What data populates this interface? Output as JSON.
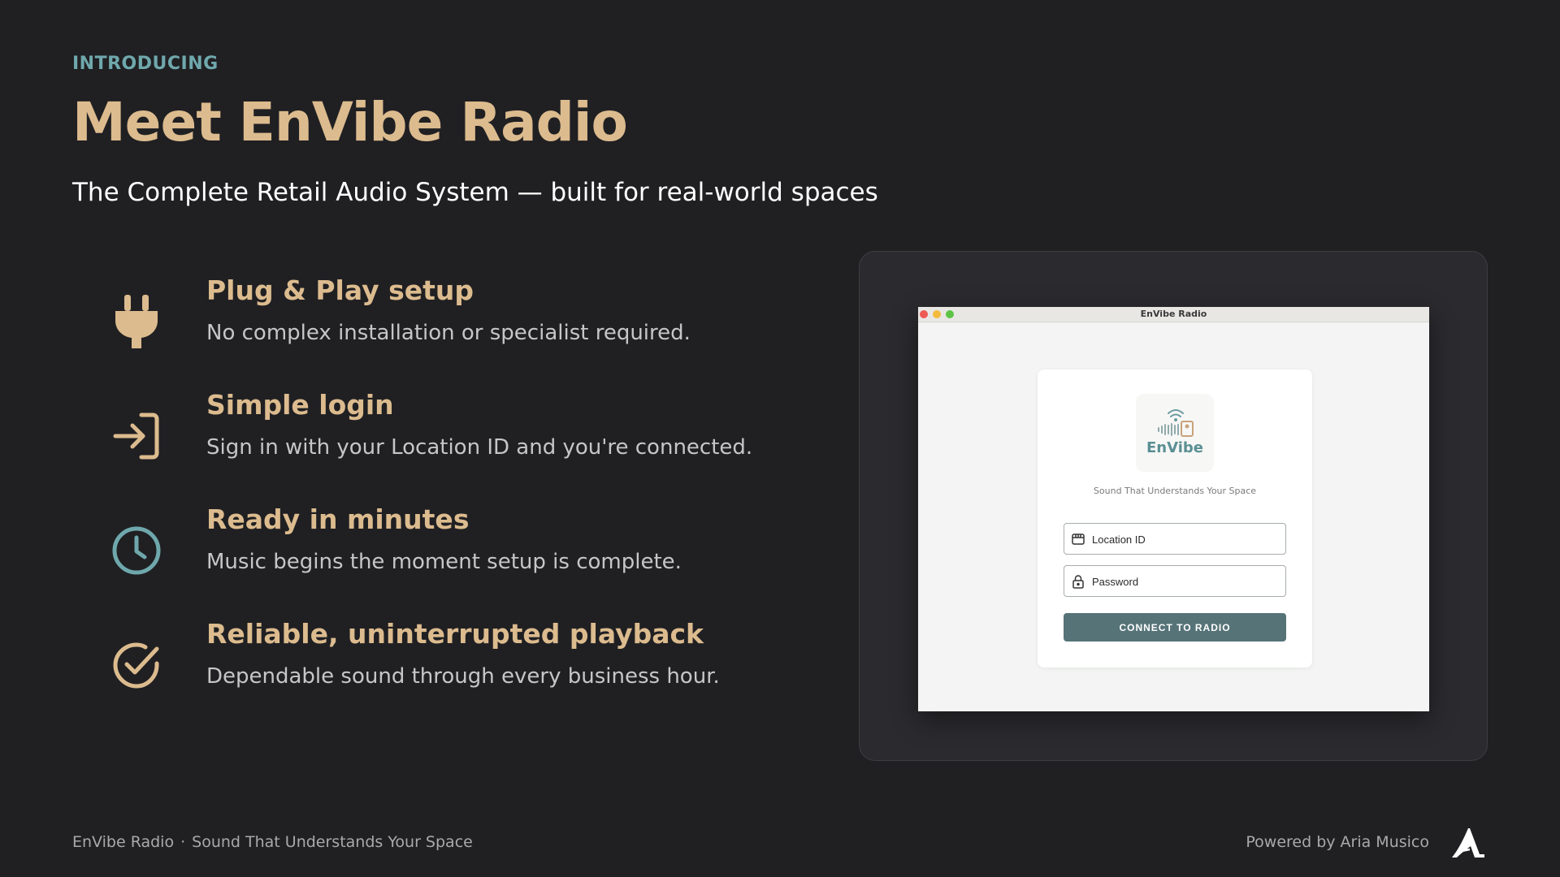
{
  "slide": {
    "eyebrow": "INTRODUCING",
    "title": "Meet EnVibe Radio",
    "subtitle": "The Complete Retail Audio System — built for real-world spaces"
  },
  "features": [
    {
      "icon": "plug-icon",
      "title": "Plug & Play setup",
      "description": "No complex installation or specialist required."
    },
    {
      "icon": "sign-in-icon",
      "title": "Simple login",
      "description": "Sign in with your Location ID and you're connected."
    },
    {
      "icon": "clock-icon",
      "title": "Ready in minutes",
      "description": "Music begins the moment setup is complete."
    },
    {
      "icon": "check-circle-icon",
      "title": "Reliable, uninterrupted playback",
      "description": "Dependable sound through every business hour."
    }
  ],
  "app_window": {
    "title": "EnVibe Radio",
    "logo_word": "EnVibe",
    "tagline": "Sound That Understands Your Space",
    "location_field": {
      "placeholder": "Location ID",
      "value": "",
      "icon": "store-icon"
    },
    "password_field": {
      "placeholder": "Password",
      "value": "",
      "icon": "lock-icon"
    },
    "connect_label": "CONNECT TO RADIO"
  },
  "footer": {
    "product": "EnVibe Radio",
    "separator": "·",
    "tagline": "Sound That Understands Your Space",
    "powered_by": "Powered by Aria Musico"
  },
  "colors": {
    "background": "#202023",
    "accent_gold": "#dcbb8e",
    "accent_teal": "#6fa8ac",
    "button": "#567378"
  }
}
